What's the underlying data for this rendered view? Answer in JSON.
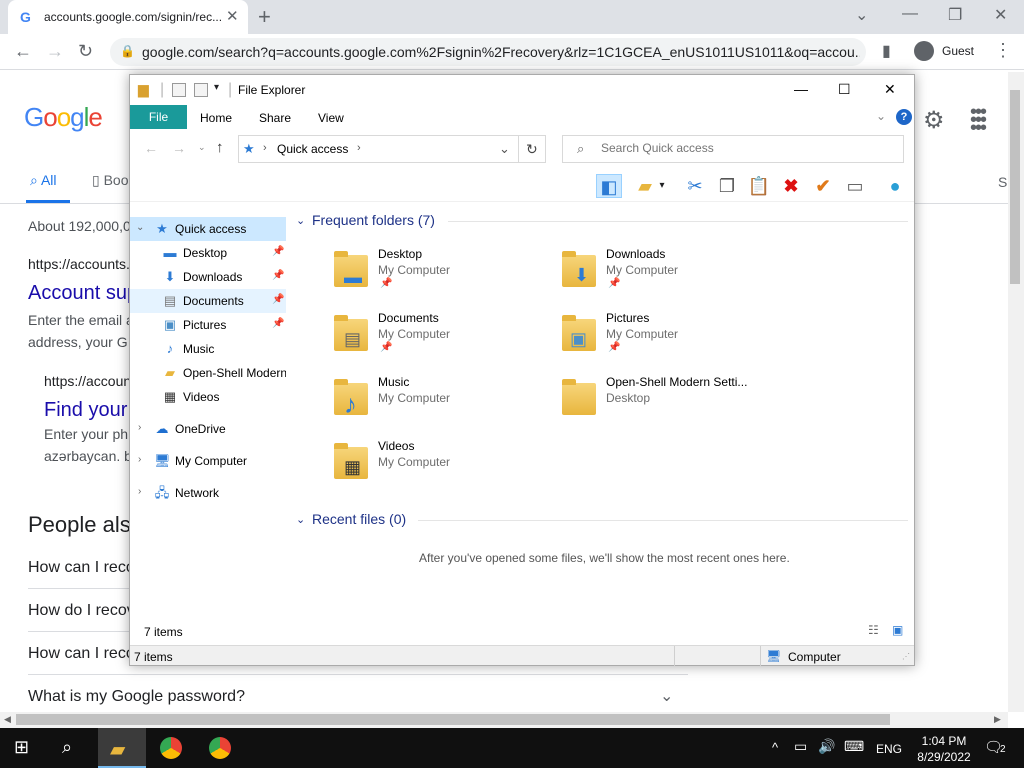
{
  "browser": {
    "tab_title": "accounts.google.com/signin/rec...",
    "new_tab": "+",
    "url": "google.com/search?q=accounts.google.com%2Fsignin%2Frecovery&rlz=1C1GCEA_enUS1011US1011&oq=accou...",
    "profile": "Guest"
  },
  "google": {
    "logo": "Google",
    "tabs": {
      "all": "All",
      "books": "Boo",
      "right": "S"
    },
    "result_count": "About 192,000,0",
    "results": [
      {
        "cite": "https://accounts.",
        "title": "Account sup",
        "snippet1": "Enter the email a",
        "snippet2": "address, your G"
      },
      {
        "cite": "https://accoun",
        "title": "Find your",
        "snippet1": "Enter your ph",
        "snippet2": "azərbaycan. b"
      }
    ],
    "people_also_ask": "People als",
    "questions": [
      "How can I reco",
      "How do I recov",
      "How can I reco",
      "What is my Google password?"
    ]
  },
  "explorer": {
    "title": "File Explorer",
    "ribbon": {
      "file": "File",
      "home": "Home",
      "share": "Share",
      "view": "View",
      "help": "?"
    },
    "address": "Quick access",
    "search_placeholder": "Search Quick access",
    "nav": {
      "quick_access": "Quick access",
      "items": [
        "Desktop",
        "Downloads",
        "Documents",
        "Pictures",
        "Music",
        "Open-Shell Modern",
        "Videos"
      ],
      "onedrive": "OneDrive",
      "computer": "My Computer",
      "network": "Network"
    },
    "frequent_header": "Frequent folders (7)",
    "folders": [
      {
        "name": "Desktop",
        "loc": "My Computer",
        "pinned": true
      },
      {
        "name": "Downloads",
        "loc": "My Computer",
        "pinned": true
      },
      {
        "name": "Documents",
        "loc": "My Computer",
        "pinned": true
      },
      {
        "name": "Pictures",
        "loc": "My Computer",
        "pinned": true
      },
      {
        "name": "Music",
        "loc": "My Computer",
        "pinned": false
      },
      {
        "name": "Open-Shell Modern Setti...",
        "loc": "Desktop",
        "pinned": false
      },
      {
        "name": "Videos",
        "loc": "My Computer",
        "pinned": false
      }
    ],
    "recent_header": "Recent files (0)",
    "recent_empty": "After you've opened some files, we'll show the most recent ones here.",
    "item_count": "7 items",
    "status_count": "7 items",
    "status_location": "Computer"
  },
  "taskbar": {
    "language": "ENG",
    "time": "1:04 PM",
    "date": "8/29/2022",
    "notifications": "2"
  },
  "colors": {
    "ribbon_file": "#1a9a9a",
    "selected": "#cce8ff",
    "link": "#1a0dab",
    "accent": "#1a73e8"
  }
}
